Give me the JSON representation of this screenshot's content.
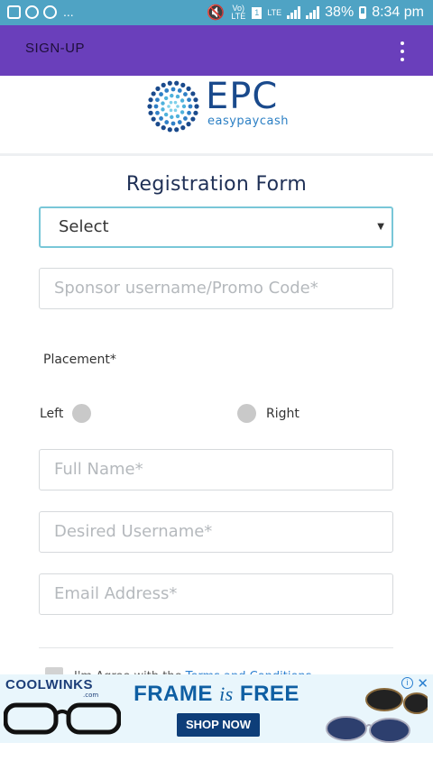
{
  "status_bar": {
    "notification_icons": [
      "gallery-icon",
      "whatsapp-icon",
      "whatsapp-icon"
    ],
    "more": "...",
    "volte": "Vo) LTE",
    "sim": "1",
    "lte": "LTE",
    "battery": "38%",
    "time": "8:34 pm"
  },
  "app_bar": {
    "title": "SIGN-UP",
    "menu_icon": "more-vert-icon",
    "color": "#6a3fbb"
  },
  "logo": {
    "name": "EPC",
    "tagline": "easypaycash"
  },
  "form": {
    "title": "Registration Form",
    "select": {
      "value": "Select"
    },
    "sponsor": {
      "placeholder": "Sponsor username/Promo Code*"
    },
    "placement_label": "Placement*",
    "radio_left": "Left",
    "radio_right": "Right",
    "full_name": {
      "placeholder": "Full Name*"
    },
    "username": {
      "placeholder": "Desired Username*"
    },
    "email": {
      "placeholder": "Email Address*"
    },
    "terms_prefix": "I'm Agree with the",
    "terms_link": "Terms and Conditions"
  },
  "ad": {
    "brand": "COOLWINKS",
    "brand_sub": ".com",
    "headline_a": "FRAME ",
    "headline_b": "is",
    "headline_c": " FREE",
    "cta": "SHOP NOW",
    "info": "i",
    "close": "✕"
  }
}
